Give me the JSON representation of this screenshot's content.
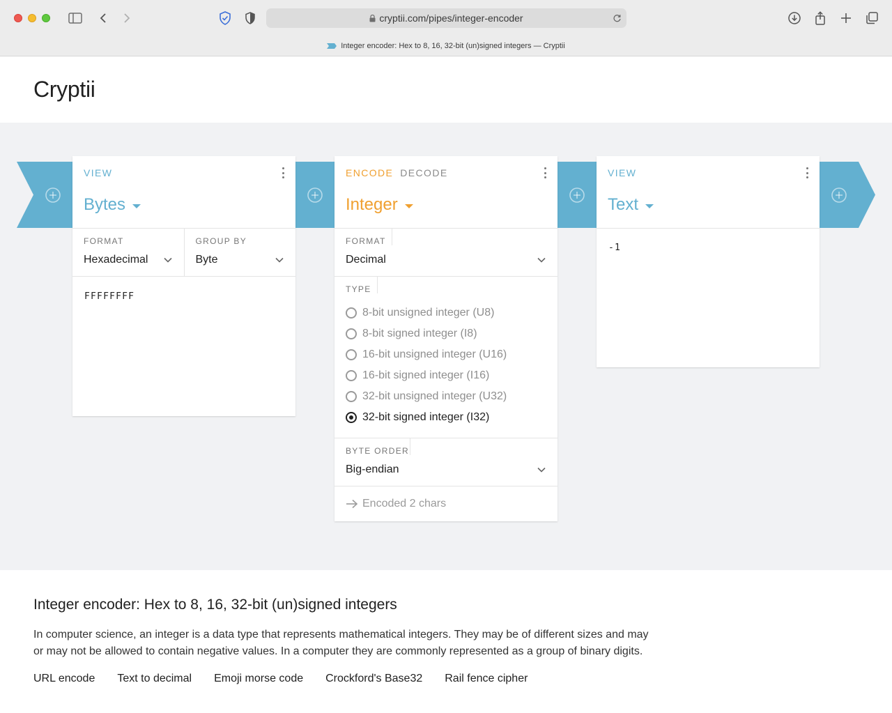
{
  "browser": {
    "url": "cryptii.com/pipes/integer-encoder",
    "tab_title": "Integer encoder: Hex to 8, 16, 32-bit (un)signed integers — Cryptii"
  },
  "site": {
    "title": "Cryptii"
  },
  "colors": {
    "view_accent": "#63b0d0",
    "encoder_accent": "#f0a030",
    "connector": "#63b0d0"
  },
  "cards": {
    "left": {
      "label": "VIEW",
      "title": "Bytes",
      "format_label": "FORMAT",
      "format_value": "Hexadecimal",
      "group_label": "GROUP BY",
      "group_value": "Byte",
      "content": "FFFFFFFF"
    },
    "middle": {
      "label_encode": "ENCODE",
      "label_decode": "DECODE",
      "title": "Integer",
      "format_label": "FORMAT",
      "format_value": "Decimal",
      "type_label": "TYPE",
      "types": [
        "8-bit unsigned integer (U8)",
        "8-bit signed integer (I8)",
        "16-bit unsigned integer (U16)",
        "16-bit signed integer (I16)",
        "32-bit unsigned integer (U32)",
        "32-bit signed integer (I32)"
      ],
      "selected_type": "32-bit signed integer (I32)",
      "byte_order_label": "BYTE ORDER",
      "byte_order_value": "Big-endian",
      "status": "Encoded 2 chars"
    },
    "right": {
      "label": "VIEW",
      "title": "Text",
      "content": "-1"
    }
  },
  "description": {
    "title": "Integer encoder: Hex to 8, 16, 32-bit (un)signed integers",
    "text": "In computer science, an integer is a data type that represents mathematical integers. They may be of different sizes and may or may not be allowed to contain negative values. In a computer they are commonly represented as a group of binary digits.",
    "links": [
      "URL encode",
      "Text to decimal",
      "Emoji morse code",
      "Crockford's Base32",
      "Rail fence cipher"
    ]
  }
}
